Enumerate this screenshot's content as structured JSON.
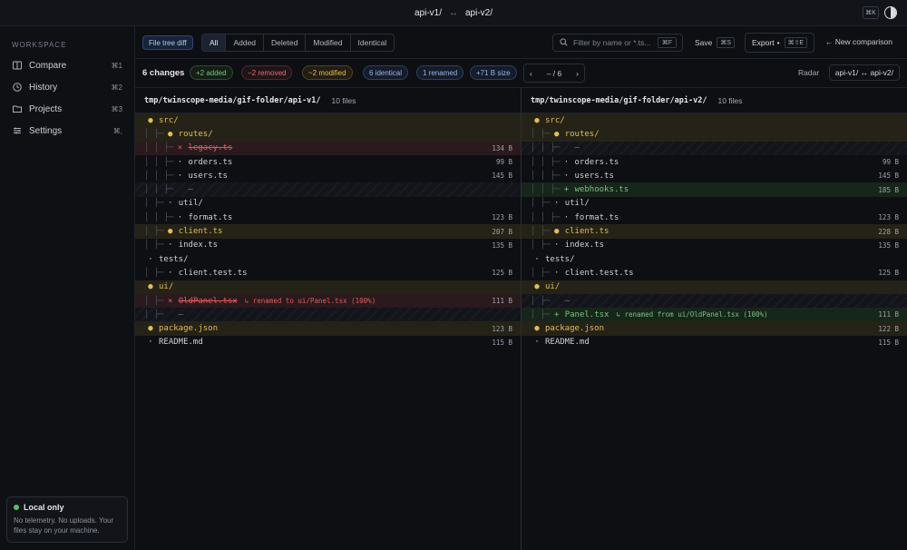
{
  "titlebar": {
    "left": "api-v1/",
    "arrow": "↔",
    "right": "api-v2/",
    "shortcut": "⌘K"
  },
  "sidebar": {
    "section": "WORKSPACE",
    "items": [
      {
        "label": "Compare",
        "shortcut": "⌘1",
        "icon": "book-icon"
      },
      {
        "label": "History",
        "shortcut": "⌘2",
        "icon": "clock-icon"
      },
      {
        "label": "Projects",
        "shortcut": "⌘3",
        "icon": "folder-icon"
      },
      {
        "label": "Settings",
        "shortcut": "⌘,",
        "icon": "sliders-icon"
      }
    ],
    "local": {
      "title": "Local only",
      "text": "No telemetry. No uploads. Your files stay on your machine."
    }
  },
  "toolbar": {
    "filetree": "File tree diff",
    "filters": [
      "All",
      "Added",
      "Deleted",
      "Modified",
      "Identical"
    ],
    "active_filter": "All",
    "filter_placeholder": "Filter by name or *.ts...",
    "filter_shortcut": "⌘F",
    "save": "Save",
    "save_shortcut": "⌘S",
    "export": "Export",
    "export_shortcut": "⌘⇧E",
    "new_comparison": "← New comparison"
  },
  "summary": {
    "changes": "6 changes",
    "added": "+2 added",
    "removed": "−2 removed",
    "modified": "~2 modified",
    "identical": "6 identical",
    "renamed": "1 renamed",
    "size": "+71 B size",
    "pager_prev": "‹",
    "pager_text": "– / 6",
    "pager_next": "›",
    "radar": "Radar",
    "compare": "api-v1/ ↔ api-v2/"
  },
  "panes": {
    "left": {
      "path": "tmp/twinscope-media/gif-folder/api-v1/",
      "count": "10 files",
      "rows": [
        {
          "ind": "",
          "mk": "●",
          "name": "src/",
          "size": "",
          "status": "mod",
          "cls": "mod"
        },
        {
          "ind": "│ ├─",
          "mk": "●",
          "name": "routes/",
          "size": "",
          "status": "mod",
          "cls": "mod"
        },
        {
          "ind": "│ │ ├─",
          "mk": "×",
          "name": "legacy.ts",
          "size": "134 B",
          "status": "del",
          "cls": "del"
        },
        {
          "ind": "│ │ ├─",
          "mk": "·",
          "name": "orders.ts",
          "size": "99 B",
          "status": "norm",
          "cls": ""
        },
        {
          "ind": "│ │ ├─",
          "mk": "·",
          "name": "users.ts",
          "size": "145 B",
          "status": "norm",
          "cls": ""
        },
        {
          "ind": "│ │ ├─",
          "mk": "",
          "name": "—",
          "size": "",
          "status": "dim",
          "cls": "ph"
        },
        {
          "ind": "│ ├─",
          "mk": "·",
          "name": "util/",
          "size": "",
          "status": "norm",
          "cls": ""
        },
        {
          "ind": "│ │ ├─",
          "mk": "·",
          "name": "format.ts",
          "size": "123 B",
          "status": "norm",
          "cls": ""
        },
        {
          "ind": "│ ├─",
          "mk": "●",
          "name": "client.ts",
          "size": "207 B",
          "status": "mod",
          "cls": "mod"
        },
        {
          "ind": "│ ├─",
          "mk": "·",
          "name": "index.ts",
          "size": "135 B",
          "status": "norm",
          "cls": ""
        },
        {
          "ind": "",
          "mk": "·",
          "name": "tests/",
          "size": "",
          "status": "norm",
          "cls": ""
        },
        {
          "ind": "│ ├─",
          "mk": "·",
          "name": "client.test.ts",
          "size": "125 B",
          "status": "norm",
          "cls": ""
        },
        {
          "ind": "",
          "mk": "●",
          "name": "ui/",
          "size": "",
          "status": "mod",
          "cls": "mod"
        },
        {
          "ind": "│ ├─",
          "mk": "×",
          "name": "OldPanel.tsx",
          "note": "↳ renamed to ui/Panel.tsx (100%)",
          "size": "111 B",
          "status": "del",
          "cls": "del"
        },
        {
          "ind": "│ ├─",
          "mk": "",
          "name": "—",
          "size": "",
          "status": "dim",
          "cls": "ph"
        },
        {
          "ind": "",
          "mk": "●",
          "name": "package.json",
          "size": "123 B",
          "status": "mod",
          "cls": "mod"
        },
        {
          "ind": "",
          "mk": "·",
          "name": "README.md",
          "size": "115 B",
          "status": "norm",
          "cls": ""
        }
      ]
    },
    "right": {
      "path": "tmp/twinscope-media/gif-folder/api-v2/",
      "count": "10 files",
      "rows": [
        {
          "ind": "",
          "mk": "●",
          "name": "src/",
          "size": "",
          "status": "mod",
          "cls": "mod"
        },
        {
          "ind": "│ ├─",
          "mk": "●",
          "name": "routes/",
          "size": "",
          "status": "mod",
          "cls": "mod"
        },
        {
          "ind": "│ │ ├─",
          "mk": "",
          "name": "—",
          "size": "",
          "status": "dim",
          "cls": "ph"
        },
        {
          "ind": "│ │ ├─",
          "mk": "·",
          "name": "orders.ts",
          "size": "99 B",
          "status": "norm",
          "cls": ""
        },
        {
          "ind": "│ │ ├─",
          "mk": "·",
          "name": "users.ts",
          "size": "145 B",
          "status": "norm",
          "cls": ""
        },
        {
          "ind": "│ │ ├─",
          "mk": "+",
          "name": "webhooks.ts",
          "size": "185 B",
          "status": "add",
          "cls": "add"
        },
        {
          "ind": "│ ├─",
          "mk": "·",
          "name": "util/",
          "size": "",
          "status": "norm",
          "cls": ""
        },
        {
          "ind": "│ │ ├─",
          "mk": "·",
          "name": "format.ts",
          "size": "123 B",
          "status": "norm",
          "cls": ""
        },
        {
          "ind": "│ ├─",
          "mk": "●",
          "name": "client.ts",
          "size": "228 B",
          "status": "mod",
          "cls": "mod"
        },
        {
          "ind": "│ ├─",
          "mk": "·",
          "name": "index.ts",
          "size": "135 B",
          "status": "norm",
          "cls": ""
        },
        {
          "ind": "",
          "mk": "·",
          "name": "tests/",
          "size": "",
          "status": "norm",
          "cls": ""
        },
        {
          "ind": "│ ├─",
          "mk": "·",
          "name": "client.test.ts",
          "size": "125 B",
          "status": "norm",
          "cls": ""
        },
        {
          "ind": "",
          "mk": "●",
          "name": "ui/",
          "size": "",
          "status": "mod",
          "cls": "mod"
        },
        {
          "ind": "│ ├─",
          "mk": "",
          "name": "—",
          "size": "",
          "status": "dim",
          "cls": "ph"
        },
        {
          "ind": "│ ├─",
          "mk": "+",
          "name": "Panel.tsx",
          "note": "↳ renamed from ui/OldPanel.tsx (100%)",
          "size": "111 B",
          "status": "add",
          "cls": "add"
        },
        {
          "ind": "",
          "mk": "●",
          "name": "package.json",
          "size": "122 B",
          "status": "mod",
          "cls": "mod"
        },
        {
          "ind": "",
          "mk": "·",
          "name": "README.md",
          "size": "115 B",
          "status": "norm",
          "cls": ""
        }
      ]
    }
  },
  "colors": {
    "modified": "#e3bd55",
    "deleted": "#e25b5b",
    "added": "#79c27f",
    "accent": "#3b5a96"
  }
}
